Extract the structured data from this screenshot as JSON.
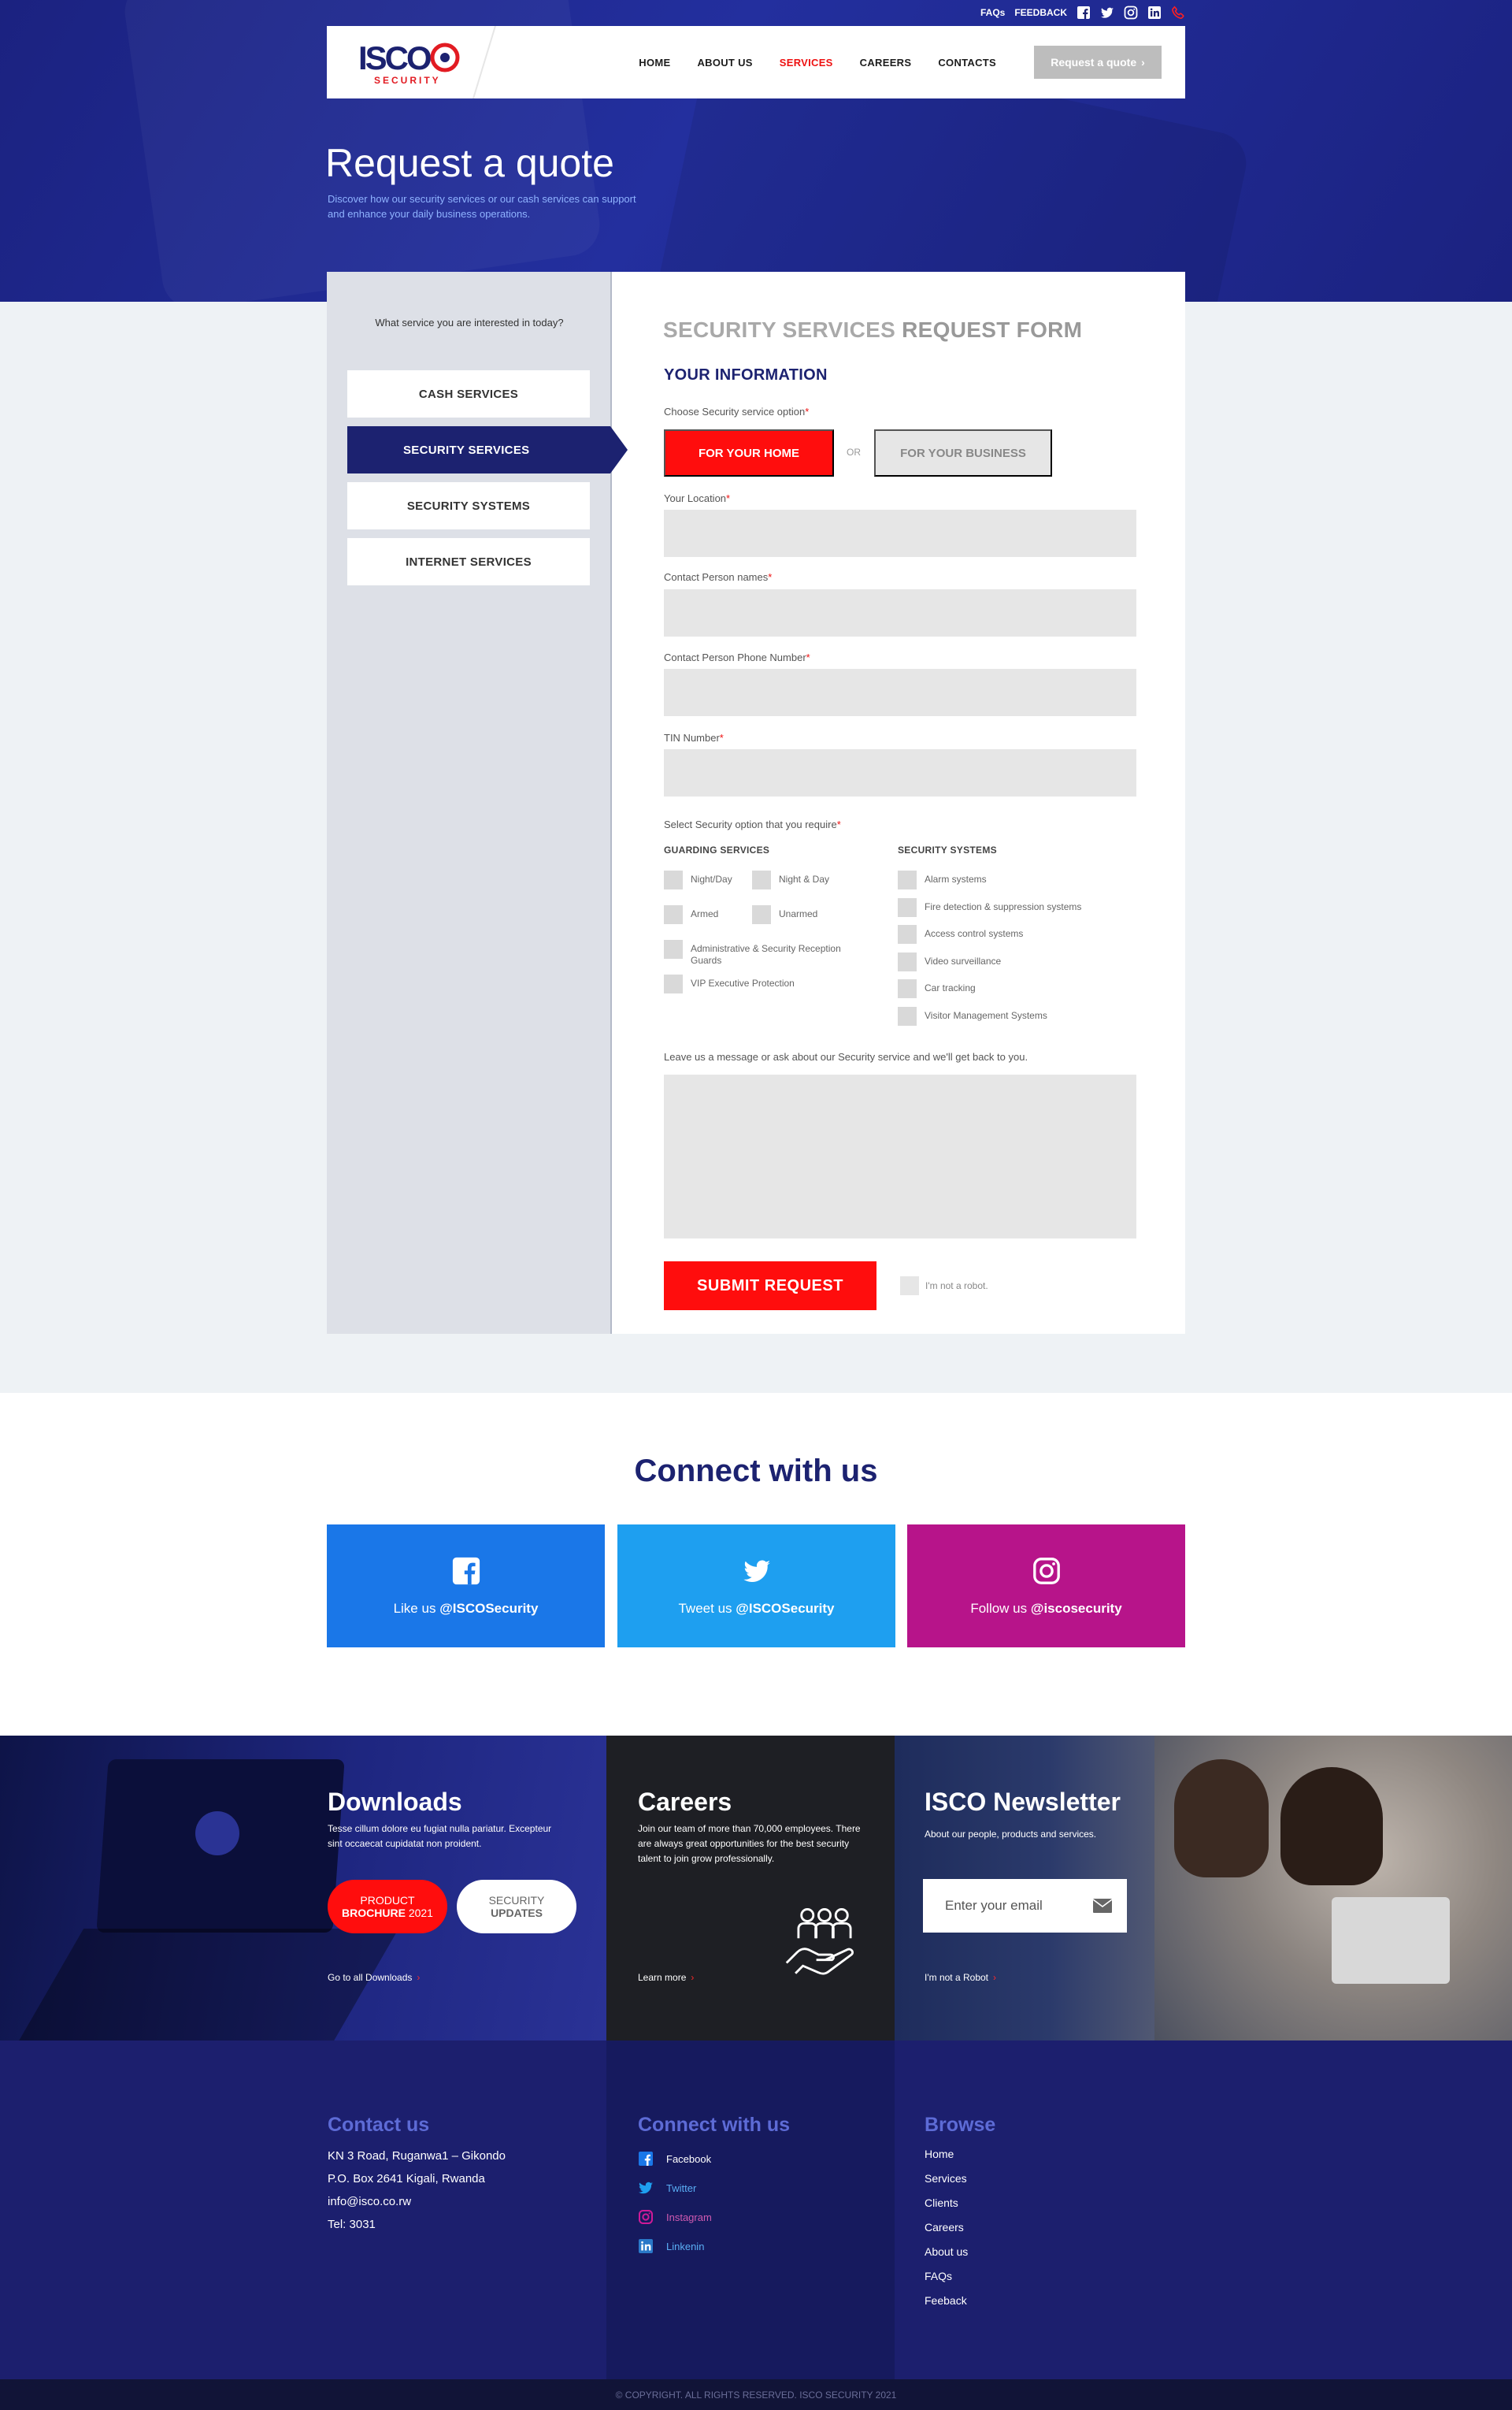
{
  "topbar": {
    "faqs": "FAQs",
    "feedback": "FEEDBACK",
    "icons": [
      "facebook-icon",
      "twitter-icon",
      "instagram-icon",
      "linkedin-icon",
      "phone-icon"
    ]
  },
  "brand": {
    "logo_text": "ISCO",
    "logo_sub": "SECURITY",
    "primary": "#1c2270",
    "accent": "#ff0d0d"
  },
  "nav": {
    "items": [
      "HOME",
      "ABOUT US",
      "SERVICES",
      "CAREERS",
      "CONTACTS"
    ],
    "active": "SERVICES",
    "quote_button": "Request a quote"
  },
  "hero": {
    "title": "Request a quote",
    "subtitle": "Discover how our security services or our cash services can support and enhance your daily business operations."
  },
  "sidebar": {
    "question": "What service you are interested in today?",
    "items": [
      {
        "label": "CASH SERVICES"
      },
      {
        "label": "SECURITY SERVICES",
        "active": true
      },
      {
        "label": "SECURITY SYSTEMS"
      },
      {
        "label": "INTERNET SERVICES"
      }
    ]
  },
  "form": {
    "title_light": "SECURITY SERVICES",
    "title_bold": "REQUEST FORM",
    "section": "YOUR INFORMATION",
    "service_option_label": "Choose Security service option",
    "option_home": "FOR YOUR HOME",
    "option_or": "OR",
    "option_business": "FOR YOUR BUSINESS",
    "location_label": "Your Location",
    "contact_label": "Contact Person names",
    "phone_label": "Contact Person Phone Number",
    "tin_label": "TIN Number",
    "required_mark": "*",
    "select_label": "Select Security option that you require",
    "guarding_title": "GUARDING SERVICES",
    "guarding": [
      "Night/Day",
      "Night & Day",
      "Armed",
      "Unarmed",
      "Administrative & Security Reception Guards",
      "VIP Executive Protection"
    ],
    "systems_title": "SECURITY SYSTEMS",
    "systems": [
      "Alarm systems",
      "Fire detection & suppression systems",
      "Access control systems",
      "Video surveillance",
      "Car tracking",
      "Visitor Management Systems"
    ],
    "message_label": "Leave us a message or ask about our Security service and we'll get back to you.",
    "submit": "SUBMIT REQUEST",
    "robot": "I'm not a robot."
  },
  "connect": {
    "title": "Connect with us",
    "facebook": {
      "prefix": "Like us",
      "handle": "@ISCOSecurity",
      "color": "#1a77e8"
    },
    "twitter": {
      "prefix": "Tweet us",
      "handle": "@ISCOSecurity",
      "color": "#1e9ff0"
    },
    "instagram": {
      "prefix": "Follow us",
      "handle": "@iscosecurity",
      "color": "#b7148a"
    }
  },
  "downloads": {
    "title": "Downloads",
    "text": "Tesse cillum dolore eu fugiat nulla pariatur. Excepteur sint occaecat cupidatat non proident.",
    "brochure_line1": "PRODUCT",
    "brochure_line2_bold": "BROCHURE",
    "brochure_year": "2021",
    "updates_line1": "SECURITY",
    "updates_line2": "UPDATES",
    "link": "Go to all Downloads"
  },
  "careers": {
    "title": "Careers",
    "text": "Join our team of more than 70,000 employees. There are always great opportunities for the best security talent to join grow professionally.",
    "link": "Learn more"
  },
  "newsletter": {
    "title": "ISCO Newsletter",
    "text": "About our people, products and services.",
    "placeholder": "Enter your email",
    "robot": "I'm not a Robot"
  },
  "footer": {
    "contact_title": "Contact us",
    "contact_lines": [
      "KN 3 Road, Ruganwa1 – Gikondo",
      "P.O. Box 2641 Kigali, Rwanda",
      "info@isco.co.rw",
      "Tel: 3031"
    ],
    "connect_title": "Connect with us",
    "connect_links": [
      "Facebook",
      "Twitter",
      "Instagram",
      "Linkenin"
    ],
    "browse_title": "Browse",
    "browse_links": [
      "Home",
      "Services",
      "Clients",
      "Careers",
      "About us",
      "FAQs",
      "Feeback"
    ],
    "copyright": "© COPYRIGHT. ALL RIGHTS RESERVED. ISCO SECURITY 2021"
  }
}
